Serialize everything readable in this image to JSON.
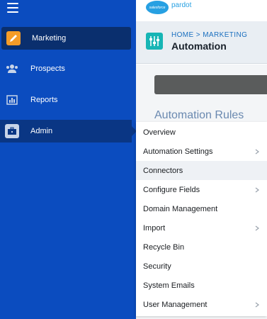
{
  "brand": {
    "logo_text": "salesforce",
    "name": "pardot"
  },
  "sidebar": {
    "items": [
      {
        "label": "Marketing",
        "icon": "pencil-icon"
      },
      {
        "label": "Prospects",
        "icon": "people-icon"
      },
      {
        "label": "Reports",
        "icon": "bar-chart-icon"
      },
      {
        "label": "Admin",
        "icon": "briefcase-icon"
      }
    ]
  },
  "header": {
    "breadcrumb": "HOME > MARKETING",
    "title": "Automation"
  },
  "content": {
    "section_title": "Automation Rules"
  },
  "admin_menu": {
    "items": [
      {
        "label": "Overview",
        "submenu": false
      },
      {
        "label": "Automation Settings",
        "submenu": true
      },
      {
        "label": "Connectors",
        "submenu": false
      },
      {
        "label": "Configure Fields",
        "submenu": true
      },
      {
        "label": "Domain Management",
        "submenu": false
      },
      {
        "label": "Import",
        "submenu": true
      },
      {
        "label": "Recycle Bin",
        "submenu": false
      },
      {
        "label": "Security",
        "submenu": false
      },
      {
        "label": "System Emails",
        "submenu": false
      },
      {
        "label": "User Management",
        "submenu": true
      }
    ],
    "hovered": "Connectors"
  },
  "colors": {
    "sidebar": "#0b4cbf",
    "active_item": "#0a2f6e",
    "marketing_accent": "#f59c28",
    "brand": "#27a0e2",
    "app_icon": "#16b5b5"
  }
}
